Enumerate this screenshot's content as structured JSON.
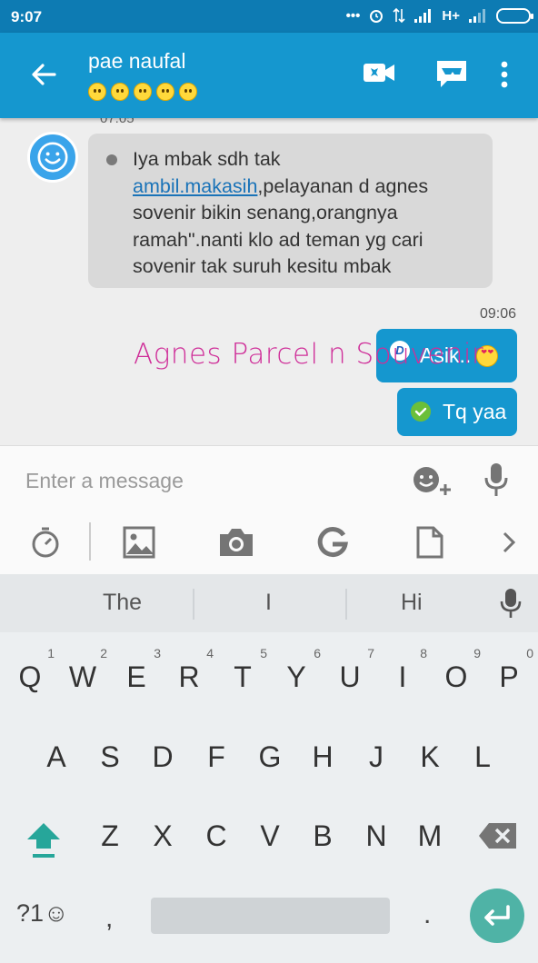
{
  "status_bar": {
    "time": "9:07",
    "network": "H+"
  },
  "header": {
    "contact_name": "pae naufal",
    "emoji_count": 5,
    "actions": [
      "video-call-icon",
      "incognito-icon",
      "more-vert-icon"
    ]
  },
  "chat": {
    "cut_time": "07:05",
    "incoming": {
      "line1": "Iya mbak sdh tak",
      "link": "ambil.makasih",
      "rest": ",pelayanan d agnes sovenir bikin senang,orangnya ramah\".nanti klo ad teman yg cari sovenir tak suruh kesitu mbak"
    },
    "outgoing_time": "09:06",
    "outgoing": [
      {
        "text": "Asik..",
        "status_icon": "D"
      },
      {
        "text": "Tq yaa"
      }
    ],
    "watermark": "Agnes Parcel n Souvenir"
  },
  "compose": {
    "placeholder": "Enter a message",
    "tools": [
      "timer-icon",
      "image-icon",
      "camera-icon",
      "google-g-icon",
      "file-icon",
      "chevron-right-icon"
    ]
  },
  "keyboard": {
    "suggestions": [
      "The",
      "I",
      "Hi"
    ],
    "row1": [
      "Q",
      "W",
      "E",
      "R",
      "T",
      "Y",
      "U",
      "I",
      "O",
      "P"
    ],
    "row1_nums": [
      "1",
      "2",
      "3",
      "4",
      "5",
      "6",
      "7",
      "8",
      "9",
      "0"
    ],
    "row2": [
      "A",
      "S",
      "D",
      "F",
      "G",
      "H",
      "J",
      "K",
      "L"
    ],
    "row3": [
      "Z",
      "X",
      "C",
      "V",
      "B",
      "N",
      "M"
    ],
    "symbols_key": "?1☺",
    "comma": ",",
    "period": "."
  },
  "colors": {
    "header": "#1597cf",
    "status": "#0d7bb3",
    "enter_key": "#4fb3a6",
    "watermark": "#cf2f99"
  }
}
